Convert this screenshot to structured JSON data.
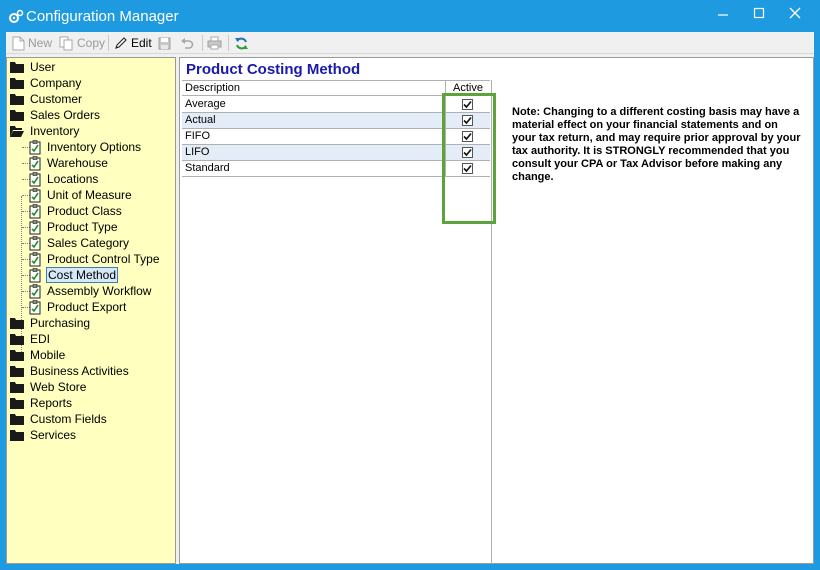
{
  "window": {
    "title": "Configuration Manager"
  },
  "toolbar": {
    "new_label": "New",
    "copy_label": "Copy",
    "edit_label": "Edit"
  },
  "tree": {
    "items": [
      {
        "label": "User"
      },
      {
        "label": "Company"
      },
      {
        "label": "Customer"
      },
      {
        "label": "Sales Orders"
      },
      {
        "label": "Inventory"
      },
      {
        "label": "Inventory Options"
      },
      {
        "label": "Warehouse"
      },
      {
        "label": "Locations"
      },
      {
        "label": "Unit of Measure"
      },
      {
        "label": "Product Class"
      },
      {
        "label": "Product Type"
      },
      {
        "label": "Sales Category"
      },
      {
        "label": "Product Control Type"
      },
      {
        "label": "Cost Method"
      },
      {
        "label": "Assembly Workflow"
      },
      {
        "label": "Product Export"
      },
      {
        "label": "Purchasing"
      },
      {
        "label": "EDI"
      },
      {
        "label": "Mobile"
      },
      {
        "label": "Business Activities"
      },
      {
        "label": "Web Store"
      },
      {
        "label": "Reports"
      },
      {
        "label": "Custom Fields"
      },
      {
        "label": "Services"
      }
    ],
    "selected": "Cost Method"
  },
  "main": {
    "heading": "Product Costing Method",
    "columns": {
      "description": "Description",
      "active": "Active"
    },
    "rows": [
      {
        "description": "Average",
        "active": true
      },
      {
        "description": "Actual",
        "active": true
      },
      {
        "description": "FIFO",
        "active": true
      },
      {
        "description": "LIFO",
        "active": true
      },
      {
        "description": "Standard",
        "active": true
      }
    ],
    "note": "Note: Changing to a different costing basis may have a material effect on your financial statements and on your tax return, and may require prior approval by your tax authority. It is STRONGLY recommended that you consult your CPA or Tax Advisor before making any change."
  },
  "colors": {
    "titlebar": "#1E9BE0",
    "tree_bg": "#FFFFC0",
    "heading": "#1A1AAA",
    "highlight": "#5BA33A",
    "alt_row": "#E4ECF7"
  }
}
